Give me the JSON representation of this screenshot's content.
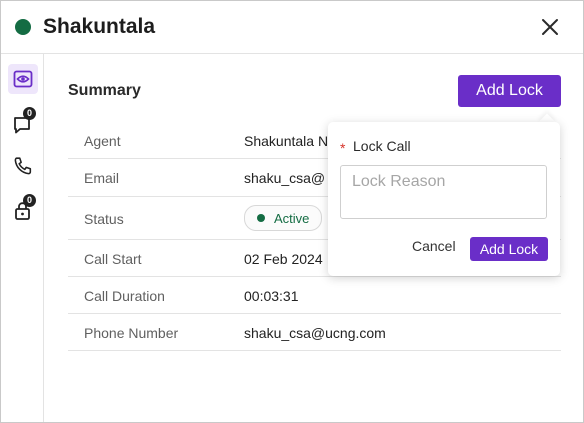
{
  "header": {
    "title": "Shakuntala",
    "status_color": "#146c43",
    "close_icon": "close-icon"
  },
  "sidebar": {
    "items": [
      {
        "name": "summary",
        "icon": "eye-icon",
        "active": true
      },
      {
        "name": "chat",
        "icon": "chat-icon",
        "badge": "0"
      },
      {
        "name": "phone",
        "icon": "phone-icon"
      },
      {
        "name": "lock",
        "icon": "lock-icon",
        "badge": "0"
      }
    ]
  },
  "main": {
    "summary_title": "Summary",
    "add_lock_label": "Add Lock",
    "rows": [
      {
        "label": "Agent",
        "value": "Shakuntala N"
      },
      {
        "label": "Email",
        "value": "shaku_csa@"
      },
      {
        "label": "Status",
        "value": "Active"
      },
      {
        "label": "Call Start",
        "value": "02 Feb 2024"
      },
      {
        "label": "Call Duration",
        "value": "00:03:31"
      },
      {
        "label": "Phone Number",
        "value": "shaku_csa@ucng.com"
      }
    ]
  },
  "popover": {
    "required_mark": "*",
    "label": "Lock Call",
    "placeholder": "Lock Reason",
    "value": "",
    "cancel_label": "Cancel",
    "submit_label": "Add Lock"
  },
  "colors": {
    "accent": "#6a2ec8",
    "active_status": "#146c43",
    "required": "#d6332a"
  }
}
